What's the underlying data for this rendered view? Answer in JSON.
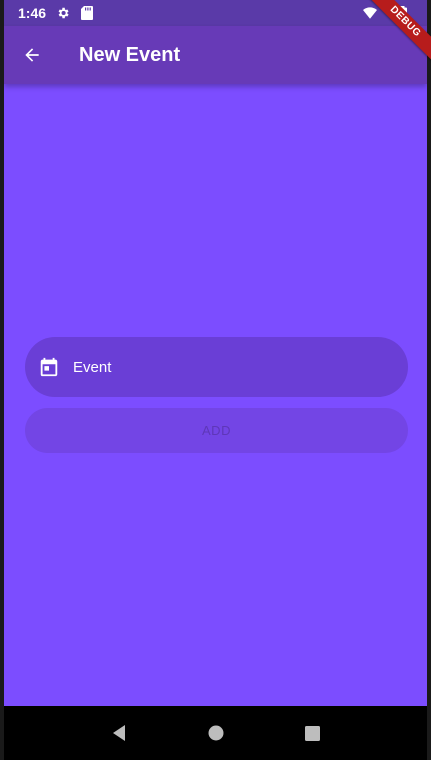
{
  "status_bar": {
    "time": "1:46",
    "left_icons": [
      "gear-icon",
      "sd-card-icon"
    ],
    "right_icons": [
      "wifi-icon",
      "battery-icon"
    ]
  },
  "debug_banner": {
    "label": "DEBUG",
    "color": "#b71c1c"
  },
  "app_bar": {
    "title": "New Event",
    "back_icon": "arrow-back-icon",
    "color": "#673ab7"
  },
  "form": {
    "event_field": {
      "icon": "calendar-icon",
      "value": "Event"
    },
    "add_button": {
      "label": "ADD",
      "enabled": false
    }
  },
  "navigation_bar": {
    "buttons": [
      "back-triangle-icon",
      "home-circle-icon",
      "recents-square-icon"
    ]
  },
  "colors": {
    "background": "#7c4dff",
    "status_bar": "#5a3aa8",
    "field": "#6a3ed6",
    "button": "#7345e5"
  }
}
